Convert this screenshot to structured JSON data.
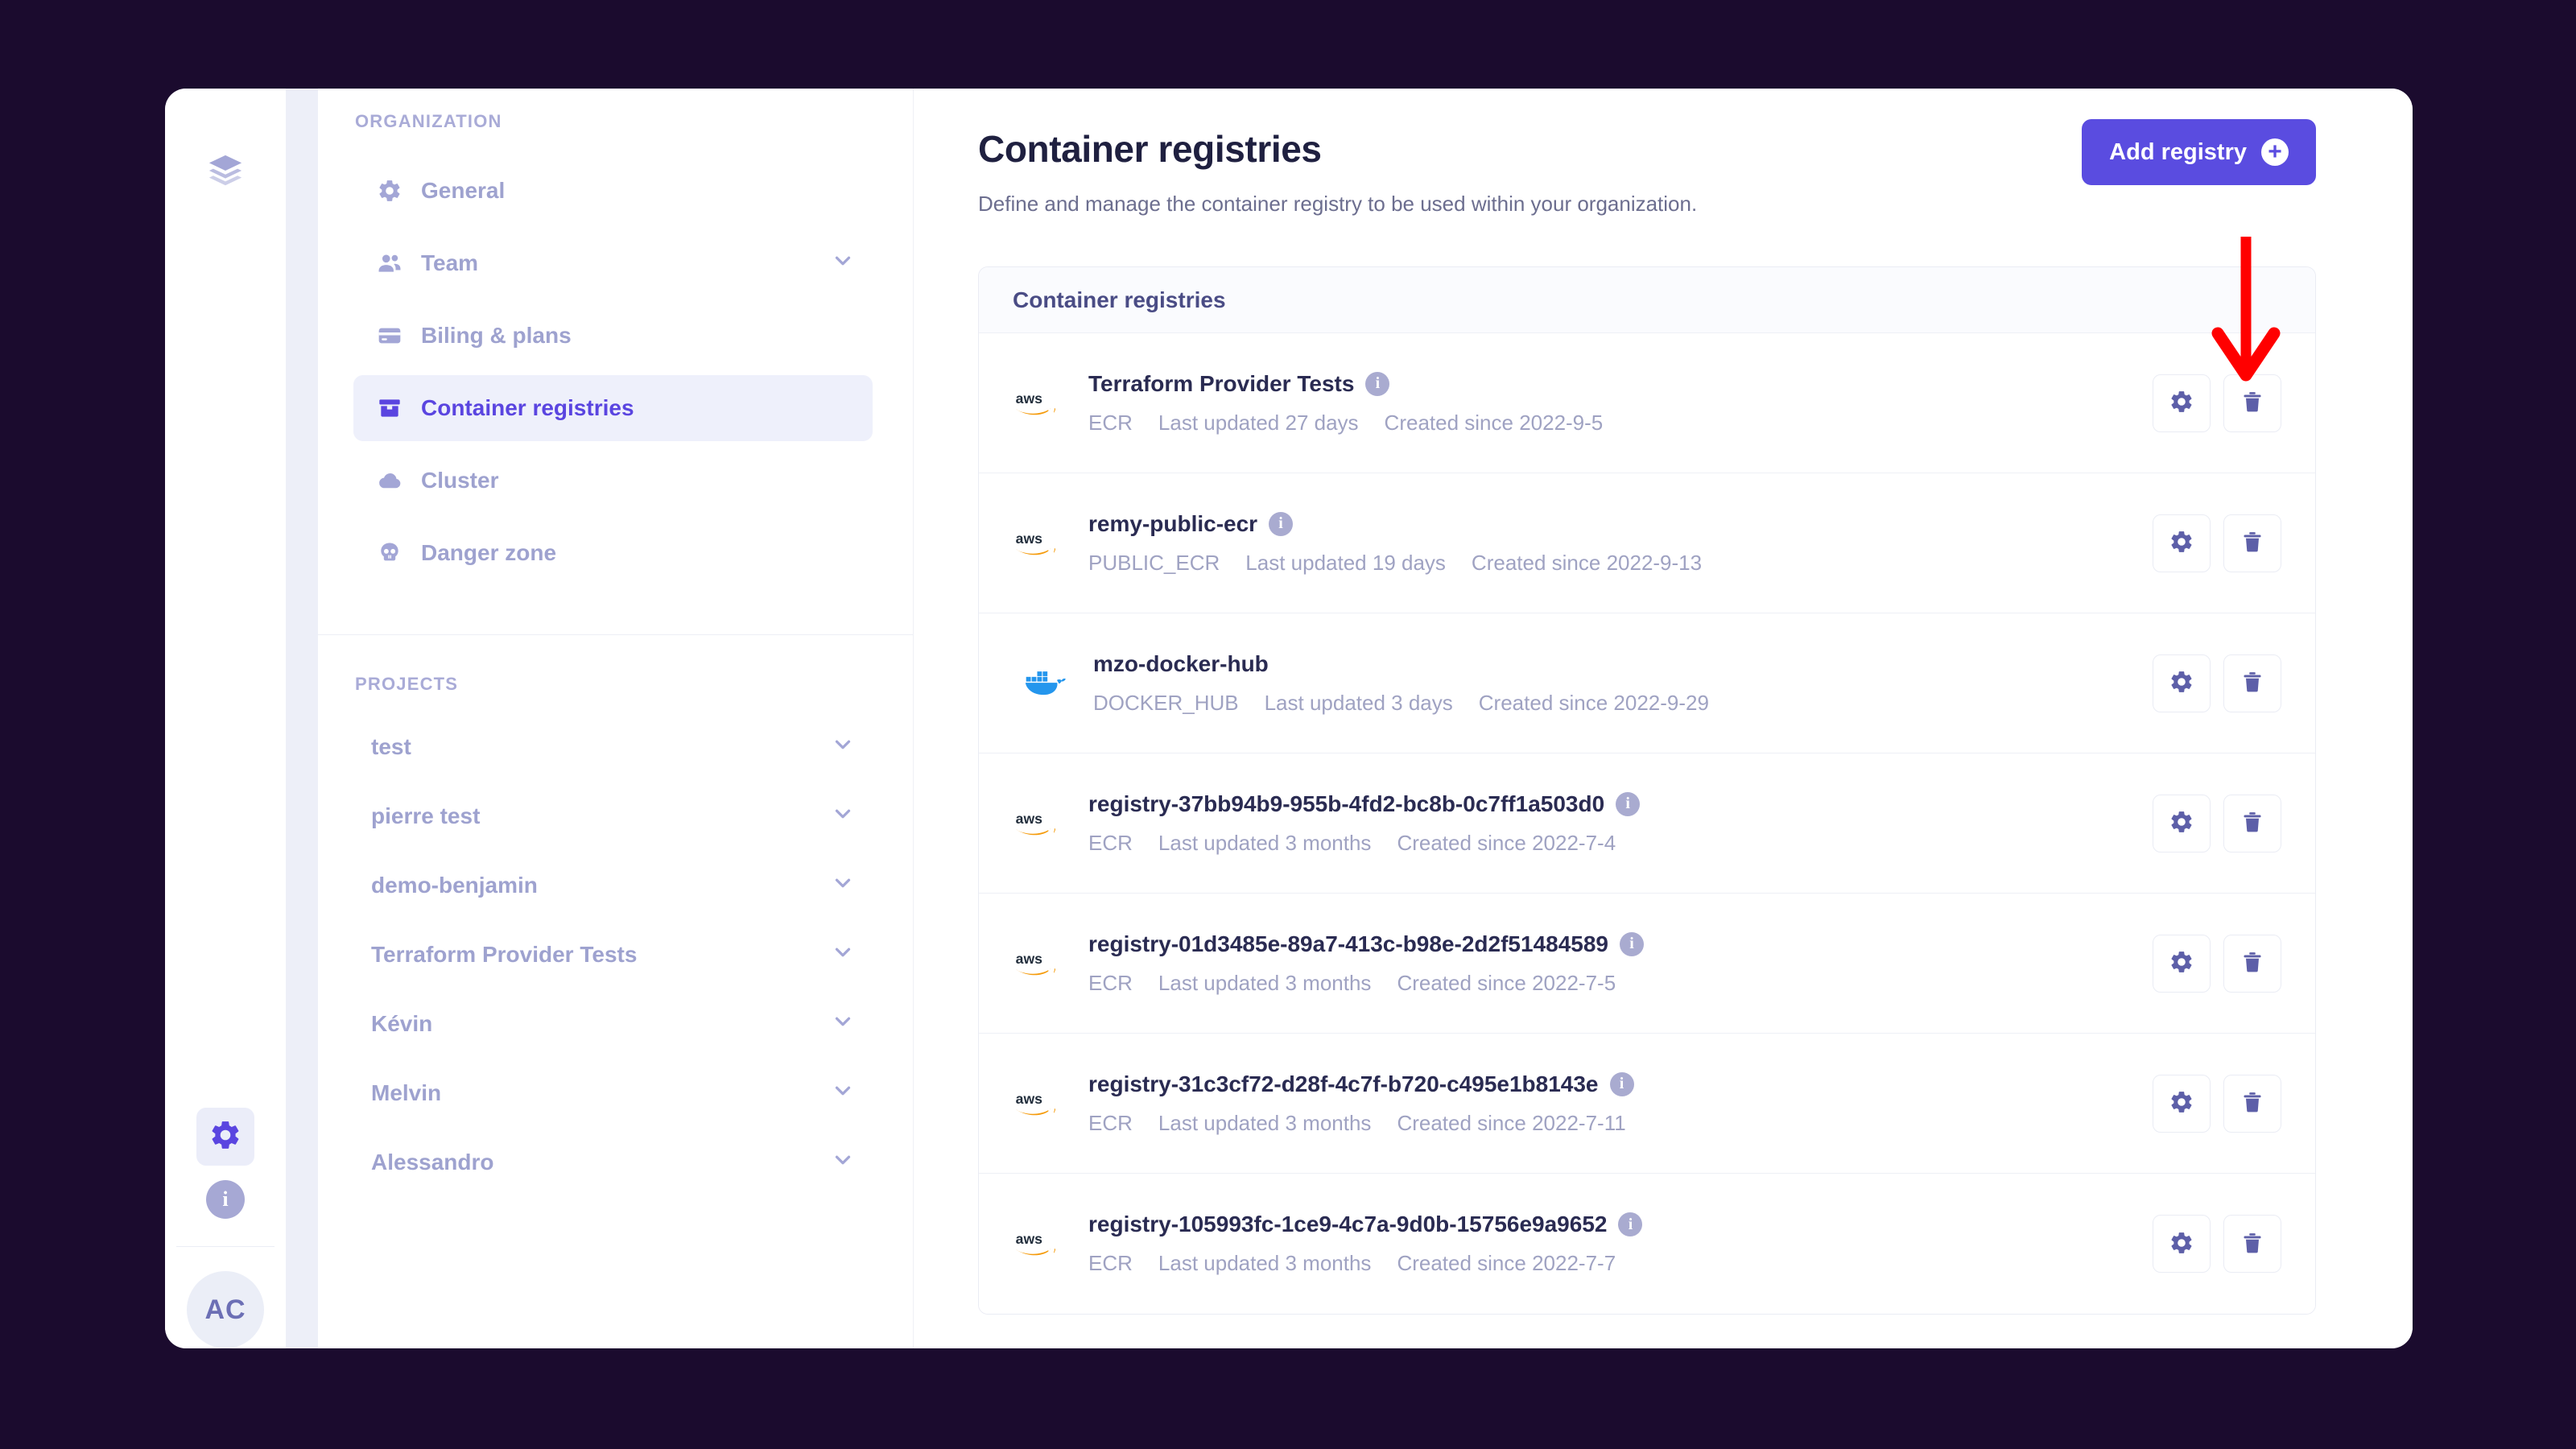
{
  "theme": {
    "background": "#1B0B2E",
    "accent": "#5A4CE0",
    "muted_text": "#9FA2C2",
    "title_text": "#1F2040",
    "annotation": "#FF0000",
    "docker_blue": "#2496ED",
    "aws_orange": "#F59B0B"
  },
  "rail": {
    "top_icon": "layers-icon",
    "settings_icon": "gear-icon",
    "info_icon": "info-icon",
    "avatar_initials": "AC"
  },
  "sidebar": {
    "organization_label": "ORGANIZATION",
    "organization_items": [
      {
        "label": "General",
        "icon": "gear-icon",
        "active": false,
        "chevron": false
      },
      {
        "label": "Team",
        "icon": "users-icon",
        "active": false,
        "chevron": true
      },
      {
        "label": "Biling & plans",
        "icon": "credit-card-icon",
        "active": false,
        "chevron": false
      },
      {
        "label": "Container registries",
        "icon": "box-icon",
        "active": true,
        "chevron": false
      },
      {
        "label": "Cluster",
        "icon": "cloud-icon",
        "active": false,
        "chevron": false
      },
      {
        "label": "Danger zone",
        "icon": "skull-icon",
        "active": false,
        "chevron": false
      }
    ],
    "projects_label": "PROJECTS",
    "projects": [
      {
        "label": "test"
      },
      {
        "label": "pierre test"
      },
      {
        "label": "demo-benjamin"
      },
      {
        "label": "Terraform Provider Tests"
      },
      {
        "label": "Kévin"
      },
      {
        "label": "Melvin"
      },
      {
        "label": "Alessandro"
      }
    ]
  },
  "main": {
    "title": "Container registries",
    "subtitle": "Define and manage the container registry to be used within your organization.",
    "add_button_label": "Add registry",
    "card_header": "Container registries",
    "settings_icon": "gear-icon",
    "delete_icon": "trash-icon",
    "registries": [
      {
        "provider": "aws",
        "name": "Terraform Provider Tests",
        "has_info": true,
        "kind": "ECR",
        "updated": "Last updated 27 days",
        "created": "Created since 2022-9-5"
      },
      {
        "provider": "aws",
        "name": "remy-public-ecr",
        "has_info": true,
        "kind": "PUBLIC_ECR",
        "updated": "Last updated 19 days",
        "created": "Created since 2022-9-13"
      },
      {
        "provider": "docker",
        "name": "mzo-docker-hub",
        "has_info": false,
        "kind": "DOCKER_HUB",
        "updated": "Last updated 3 days",
        "created": "Created since 2022-9-29"
      },
      {
        "provider": "aws",
        "name": "registry-37bb94b9-955b-4fd2-bc8b-0c7ff1a503d0",
        "has_info": true,
        "kind": "ECR",
        "updated": "Last updated 3 months",
        "created": "Created since 2022-7-4"
      },
      {
        "provider": "aws",
        "name": "registry-01d3485e-89a7-413c-b98e-2d2f51484589",
        "has_info": true,
        "kind": "ECR",
        "updated": "Last updated 3 months",
        "created": "Created since 2022-7-5"
      },
      {
        "provider": "aws",
        "name": "registry-31c3cf72-d28f-4c7f-b720-c495e1b8143e",
        "has_info": true,
        "kind": "ECR",
        "updated": "Last updated 3 months",
        "created": "Created since 2022-7-11"
      },
      {
        "provider": "aws",
        "name": "registry-105993fc-1ce9-4c7a-9d0b-15756e9a9652",
        "has_info": true,
        "kind": "ECR",
        "updated": "Last updated 3 months",
        "created": "Created since 2022-7-7"
      }
    ]
  },
  "annotation": {
    "type": "arrow-down",
    "color": "#FF0000",
    "points_to": "delete-registry-button-row-1"
  }
}
